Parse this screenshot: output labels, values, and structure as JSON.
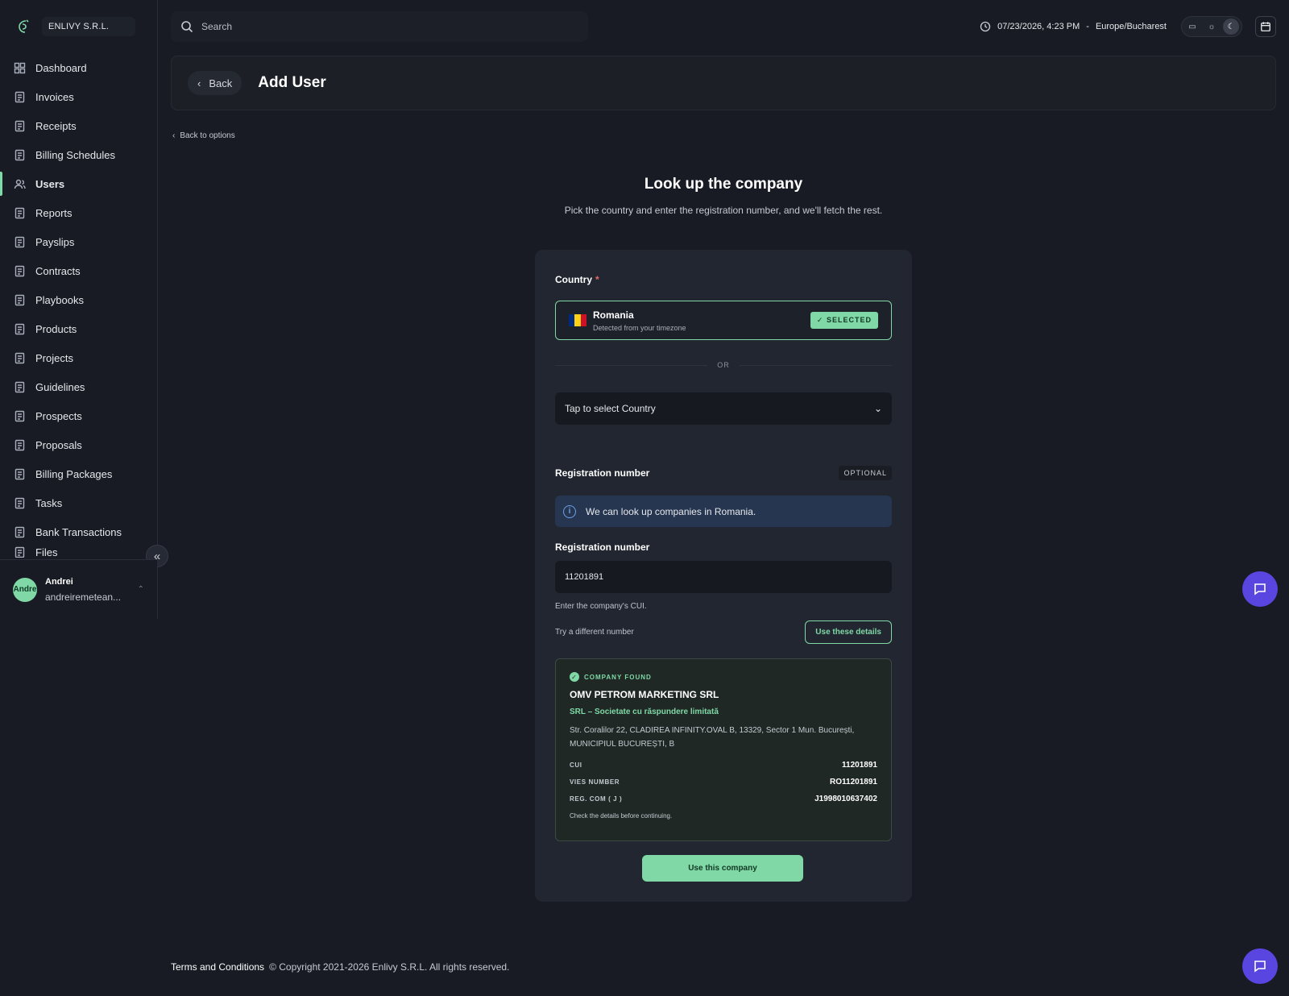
{
  "brand": {
    "name": "ENLIVY S.R.L."
  },
  "sidebar": {
    "items": [
      {
        "label": "Dashboard",
        "icon": "dashboard-icon"
      },
      {
        "label": "Invoices",
        "icon": "invoice-icon"
      },
      {
        "label": "Receipts",
        "icon": "receipt-icon"
      },
      {
        "label": "Billing Schedules",
        "icon": "billing-schedule-icon"
      },
      {
        "label": "Users",
        "icon": "users-icon",
        "active": true
      },
      {
        "label": "Reports",
        "icon": "report-icon"
      },
      {
        "label": "Payslips",
        "icon": "payslip-icon"
      },
      {
        "label": "Contracts",
        "icon": "contract-icon"
      },
      {
        "label": "Playbooks",
        "icon": "playbook-icon"
      },
      {
        "label": "Products",
        "icon": "product-icon"
      },
      {
        "label": "Projects",
        "icon": "project-icon"
      },
      {
        "label": "Guidelines",
        "icon": "guideline-icon"
      },
      {
        "label": "Prospects",
        "icon": "prospect-icon"
      },
      {
        "label": "Proposals",
        "icon": "proposal-icon"
      },
      {
        "label": "Billing Packages",
        "icon": "billing-package-icon"
      },
      {
        "label": "Tasks",
        "icon": "task-icon"
      },
      {
        "label": "Bank Transactions",
        "icon": "bank-icon"
      },
      {
        "label": "Files",
        "icon": "file-icon"
      }
    ],
    "user": {
      "name": "Andrei",
      "email": "andreiremetean...",
      "avatar_text": "Andre"
    }
  },
  "topbar": {
    "search_placeholder": "Search",
    "datetime": "07/23/2026, 4:23 PM",
    "separator": "-",
    "timezone": "Europe/Bucharest"
  },
  "header": {
    "back_label": "Back",
    "title": "Add User"
  },
  "breadcrumb": {
    "back_to_options": "Back to options"
  },
  "lookup": {
    "title": "Look up the company",
    "subtitle": "Pick the country and enter the registration number, and we'll fetch the rest."
  },
  "form": {
    "country_label": "Country",
    "required_mark": "*",
    "selected_country": {
      "name": "Romania",
      "detail": "Detected from your timezone",
      "badge": "SELECTED",
      "flag_colors": [
        "#002b7f",
        "#fcd116",
        "#ce1126"
      ]
    },
    "or_label": "OR",
    "country_select_placeholder": "Tap to select Country",
    "registration_section_label": "Registration number",
    "optional_badge": "OPTIONAL",
    "info_text": "We can look up companies in Romania.",
    "registration_input_label": "Registration number",
    "registration_value": "11201891",
    "registration_hint": "Enter the company's CUI.",
    "try_different": "Try a different number",
    "use_details_button": "Use these details",
    "company": {
      "found_label": "COMPANY FOUND",
      "name": "OMV PETROM MARKETING SRL",
      "type": "SRL – Societate cu răspundere limitată",
      "address": "Str. Coralilor 22, CLADIREA INFINITY.OVAL B, 13329, Sector 1 Mun. București, MUNICIPIUL BUCUREȘTI, B",
      "fields": [
        {
          "key": "CUI",
          "value": "11201891"
        },
        {
          "key": "VIES NUMBER",
          "value": "RO11201891"
        },
        {
          "key": "REG. COM ( J )",
          "value": "J1998010637402"
        }
      ],
      "note": "Check the details before continuing."
    },
    "use_company_button": "Use this company"
  },
  "footer": {
    "terms": "Terms and Conditions",
    "copyright": "© Copyright 2021-2026 Enlivy S.R.L. All rights reserved."
  },
  "colors": {
    "accent": "#7fd8a6",
    "chat": "#5945e0",
    "info": "#263650"
  }
}
